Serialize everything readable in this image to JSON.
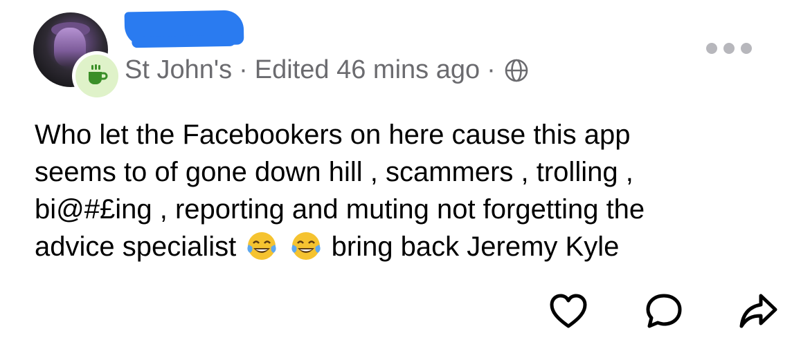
{
  "post": {
    "community_name": "St John's",
    "separator": "·",
    "edited_status": "Edited 46 mins ago",
    "visibility_icon": "globe-icon",
    "community_badge_icon": "coffee-cup-icon",
    "menu_icon": "more-dots-icon",
    "text_lines": [
      "Who let the Facebookers on here cause this app",
      "seems to of gone down hill , scammers , trolling ,",
      "bi@#£ing , reporting and muting not forgetting  the",
      "advice specialist"
    ],
    "text_tail": "bring back Jeremy Kyle",
    "emoji": [
      "😂",
      "😂"
    ]
  },
  "actions": {
    "like_icon": "heart-icon",
    "comment_icon": "comment-bubble-icon",
    "share_icon": "share-arrow-icon"
  },
  "colors": {
    "badge_green": "#3a8f28",
    "badge_bg": "#dff2c9",
    "meta_gray": "#6b6b6f",
    "redaction_blue": "#2a7bf0"
  }
}
